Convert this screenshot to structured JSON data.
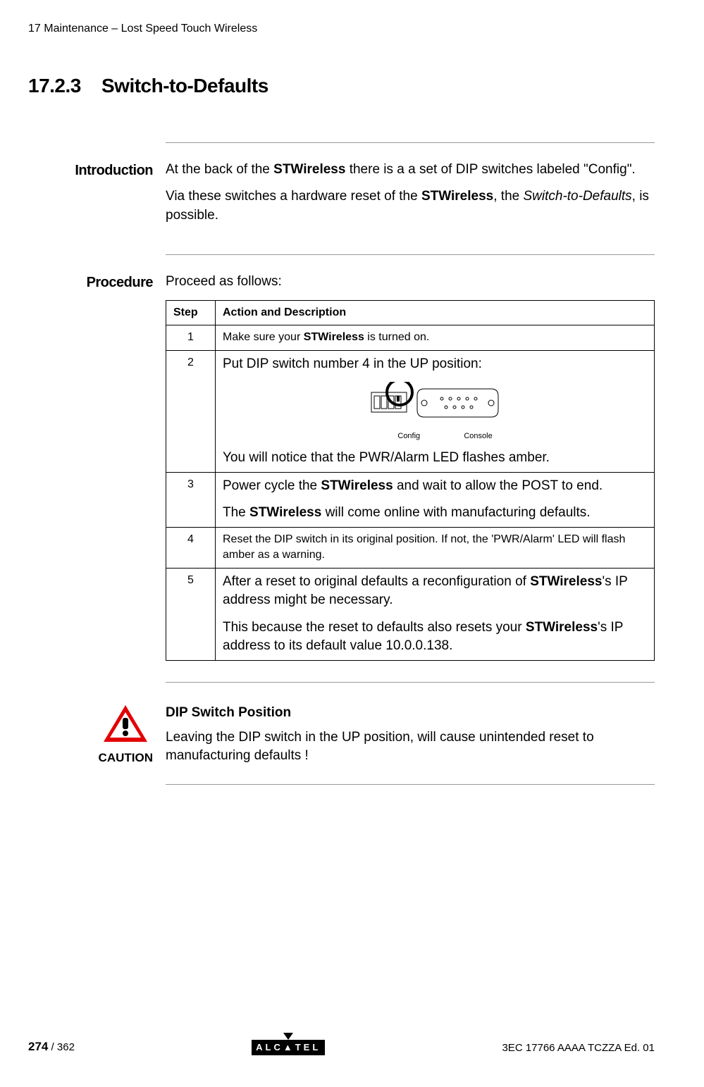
{
  "header": "17 Maintenance – Lost Speed Touch Wireless",
  "section_number": "17.2.3",
  "section_title": "Switch-to-Defaults",
  "intro": {
    "heading": "Introduction",
    "p1_a": "At the back of the ",
    "p1_bold1": "STWireless",
    "p1_b": " there is a a set of DIP switches labeled \"Config\".",
    "p2_a": "Via these switches a hardware reset of the ",
    "p2_bold": "STWireless",
    "p2_b": ", the ",
    "p2_italic": "Switch-to-Defaults",
    "p2_c": ", is possible."
  },
  "procedure": {
    "heading": "Procedure",
    "lead": "Proceed as follows:",
    "th_step": "Step",
    "th_action": "Action and Description",
    "rows": {
      "r1": {
        "step": "1",
        "a": "Make sure your ",
        "b": "STWireless",
        "c": " is turned on."
      },
      "r2": {
        "step": "2",
        "a": "Put DIP switch number 4 in the UP position:",
        "label_config": "Config",
        "label_console": "Console",
        "b": "You will notice that the PWR/Alarm LED flashes amber."
      },
      "r3": {
        "step": "3",
        "a": "Power cycle the ",
        "b": "STWireless",
        "c": " and wait to allow the POST to end.",
        "d": "The ",
        "e": "STWireless",
        "f": " will come online with manufacturing defaults."
      },
      "r4": {
        "step": "4",
        "a": "Reset the DIP switch in its original position. If not, the 'PWR/Alarm' LED will flash amber as a warning."
      },
      "r5": {
        "step": "5",
        "a": "After a reset to original defaults a reconfiguration of ",
        "b": "STWireless",
        "c": "'s IP address might be necessary.",
        "d": "This because the reset to defaults also resets your ",
        "e": "STWireless",
        "f": "'s IP address to its default value 10.0.0.138."
      }
    }
  },
  "caution": {
    "label": "CAUTION",
    "title": "DIP Switch Position",
    "text": "Leaving the DIP switch in the UP position, will cause unintended reset to manufacturing defaults !"
  },
  "footer": {
    "page_current": "274",
    "page_sep": " / ",
    "page_total": "362",
    "logo_text": "ALC▲TEL",
    "doc_id": "3EC 17766 AAAA TCZZA Ed. 01"
  }
}
